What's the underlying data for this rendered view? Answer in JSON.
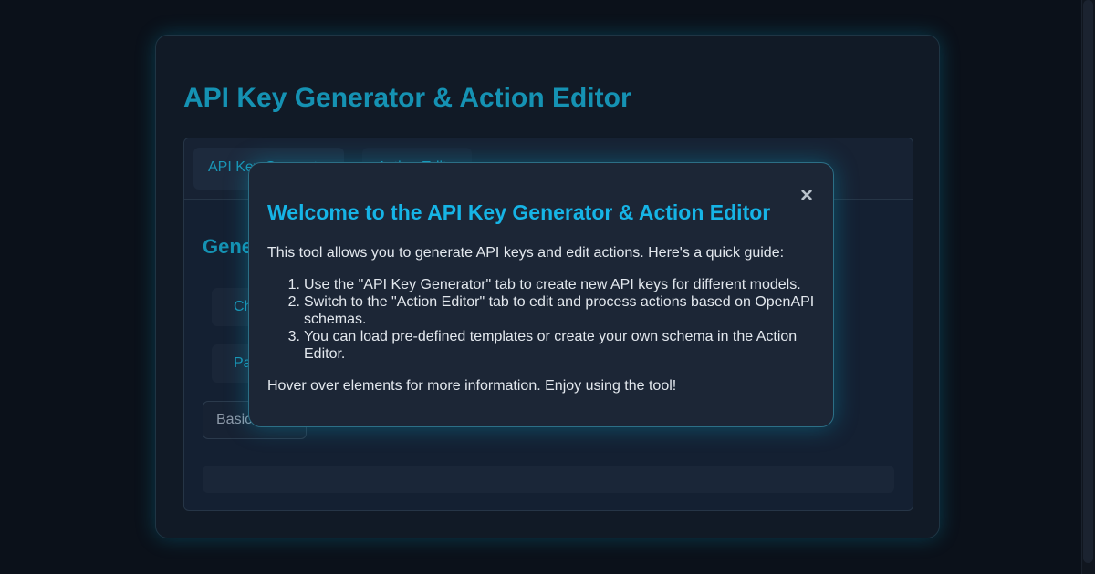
{
  "app": {
    "title": "API Key Generator & Action Editor"
  },
  "tabs": [
    {
      "label": "API Key Generator"
    },
    {
      "label": "Action Editor"
    }
  ],
  "generator": {
    "section_title": "Generate API Key",
    "buttons": [
      {
        "label": "Choose Model"
      },
      {
        "label": "Parameters"
      }
    ],
    "select_value": "Basic"
  },
  "modal": {
    "title": "Welcome to the API Key Generator & Action Editor",
    "close_icon": "close-icon",
    "intro": "This tool allows you to generate API keys and edit actions. Here's a quick guide:",
    "steps": [
      "Use the \"API Key Generator\" tab to create new API keys for different models.",
      "Switch to the \"Action Editor\" tab to edit and process actions based on OpenAPI schemas.",
      "You can load pre-defined templates or create your own schema in the Action Editor."
    ],
    "outro": "Hover over elements for more information. Enjoy using the tool!"
  },
  "colors": {
    "accent": "#1592b3",
    "modal_title": "#16b4e6",
    "background": "#0b111a"
  }
}
